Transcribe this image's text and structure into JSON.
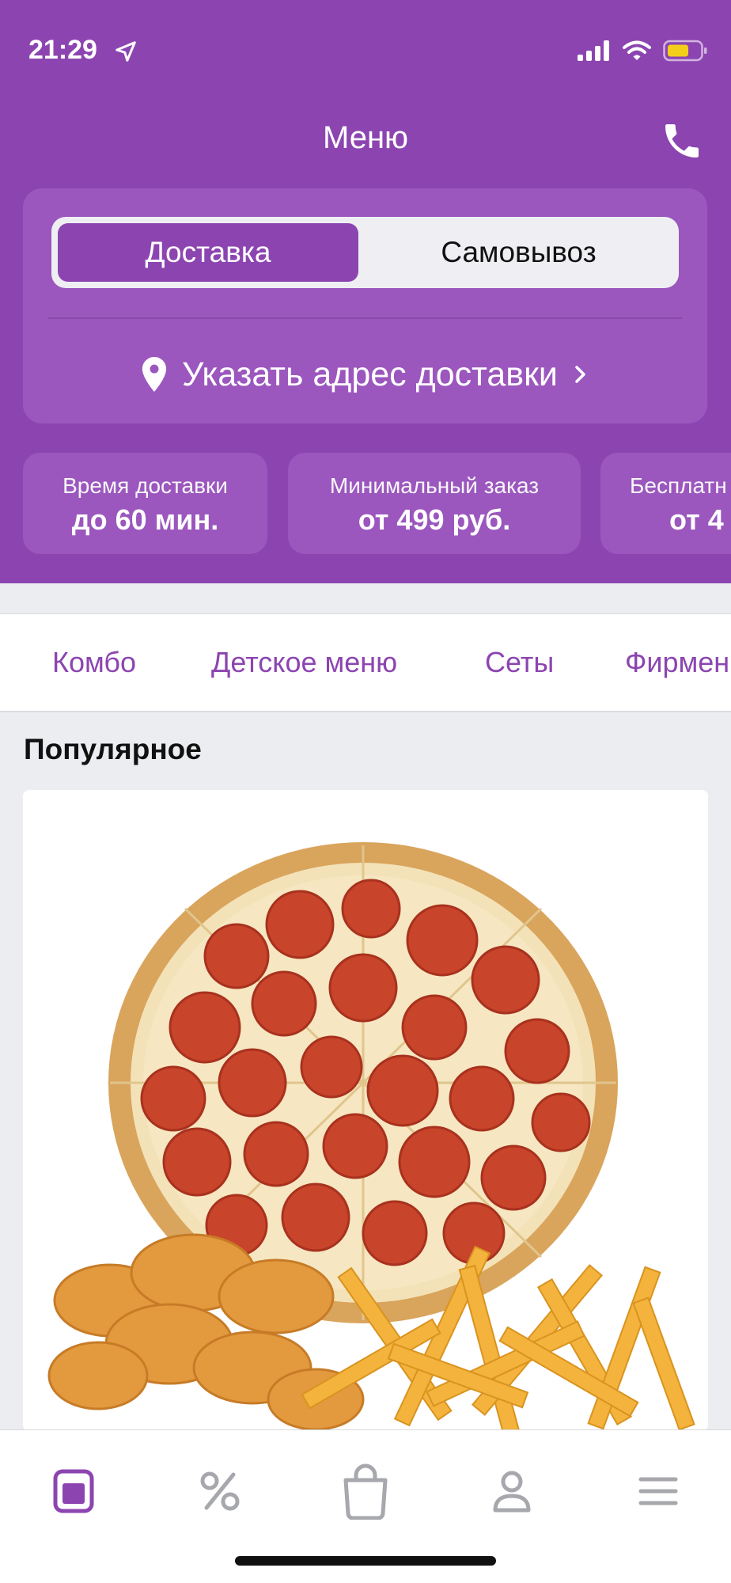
{
  "status_bar": {
    "time": "21:29"
  },
  "header": {
    "title": "Меню"
  },
  "delivery": {
    "options": [
      {
        "label": "Доставка",
        "selected": true
      },
      {
        "label": "Самовывоз",
        "selected": false
      }
    ],
    "address_prompt": "Указать адрес доставки"
  },
  "info_cards": [
    {
      "label": "Время доставки",
      "value": "до 60 мин."
    },
    {
      "label": "Минимальный заказ",
      "value": "от 499 руб."
    },
    {
      "label": "Бесплатн",
      "value": "от 4"
    }
  ],
  "categories": [
    "Комбо",
    "Детское меню",
    "Сеты",
    "Фирмен"
  ],
  "section": {
    "title": "Популярное"
  },
  "tabbar": {
    "items": [
      {
        "icon": "menu-icon",
        "active": true
      },
      {
        "icon": "percent-icon",
        "active": false
      },
      {
        "icon": "bag-icon",
        "active": false
      },
      {
        "icon": "profile-icon",
        "active": false
      },
      {
        "icon": "hamburger-icon",
        "active": false
      }
    ]
  },
  "colors": {
    "brand": "#8C45B0",
    "card": "#9B57BE",
    "inactive_icon": "#A7A8AD",
    "background": "#ECEDF1"
  }
}
